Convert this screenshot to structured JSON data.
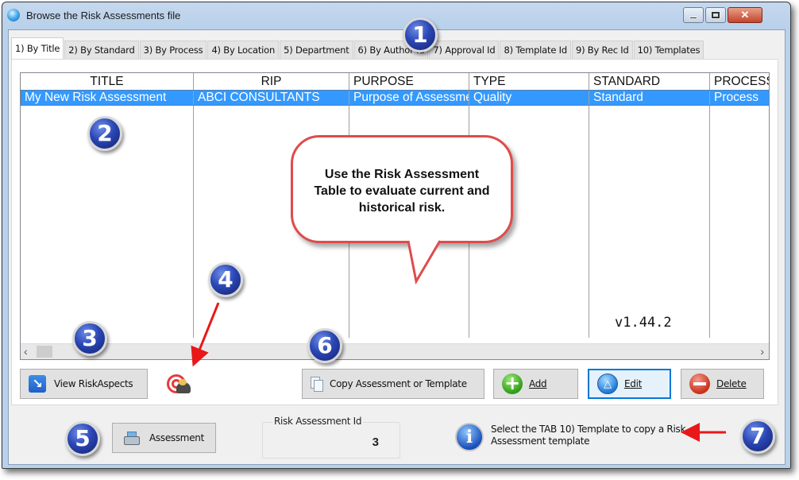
{
  "window": {
    "title": "Browse the Risk Assessments file",
    "close_label": "✕"
  },
  "tabs": [
    {
      "label": "1) By Title",
      "active": true
    },
    {
      "label": "2) By Standard"
    },
    {
      "label": "3) By Process"
    },
    {
      "label": "4) By Location"
    },
    {
      "label": "5) Department"
    },
    {
      "label": "6) By Author Id"
    },
    {
      "label": "7) Approval Id"
    },
    {
      "label": "8) Template Id"
    },
    {
      "label": "9) By Rec Id"
    },
    {
      "label": "10) Templates"
    }
  ],
  "grid": {
    "columns": [
      "TITLE",
      "RIP",
      "PURPOSE",
      "TYPE",
      "STANDARD",
      "PROCESS"
    ],
    "rows": [
      [
        "My New Risk Assessment",
        "ABCI CONSULTANTS",
        "Purpose of Assessment",
        "Quality",
        "Standard",
        "Process"
      ]
    ],
    "scroll_left": "‹",
    "scroll_right": "›"
  },
  "version": "v1.44.2",
  "buttons": {
    "view_risk_aspects": "View RiskAspects",
    "copy": "Copy Assessment or Template",
    "add": "Add",
    "edit": "Edit",
    "delete": "Delete",
    "assessment": "Assessment"
  },
  "icons": {
    "view_arrow": "↘",
    "add_plus": "+",
    "edit_triangle": "△",
    "info": "i"
  },
  "id_box": {
    "label": "Risk Assessment Id",
    "value": "3"
  },
  "info_message": "Select the TAB 10) Template to copy a Risk Assessment template",
  "callout": {
    "text": "Use the Risk Assessment Table to evaluate current and historical risk."
  },
  "badges": [
    "1",
    "2",
    "3",
    "4",
    "5",
    "6",
    "7"
  ],
  "colors": {
    "selection": "#3399ff",
    "badge": "#2b47b5",
    "callout_border": "#e04b4b",
    "arrow": "#e81818",
    "focus": "#0078d7"
  }
}
